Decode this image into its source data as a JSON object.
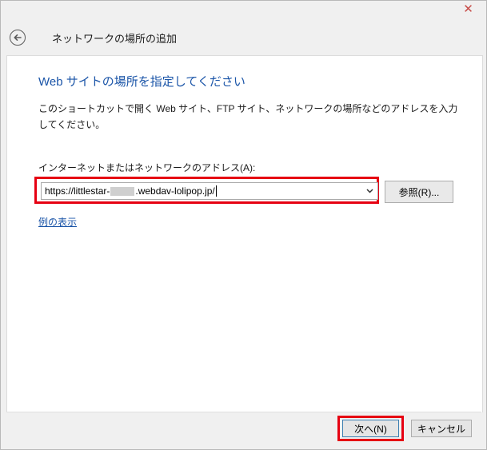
{
  "window": {
    "close_glyph": "✕",
    "title": "ネットワークの場所の追加"
  },
  "main": {
    "heading": "Web サイトの場所を指定してください",
    "description": "このショートカットで開く Web サイト、FTP サイト、ネットワークの場所などのアドレスを入力してください。",
    "address_label": "インターネットまたはネットワークのアドレス(A):",
    "address_value_start": "https://littlestar-",
    "address_value_end": ".webdav-lolipop.jp/",
    "browse_label": "参照(R)...",
    "example_link": "例の表示"
  },
  "footer": {
    "next_label": "次へ(N)",
    "cancel_label": "キャンセル"
  },
  "colors": {
    "highlight": "#e60012",
    "heading": "#1b55a8"
  }
}
